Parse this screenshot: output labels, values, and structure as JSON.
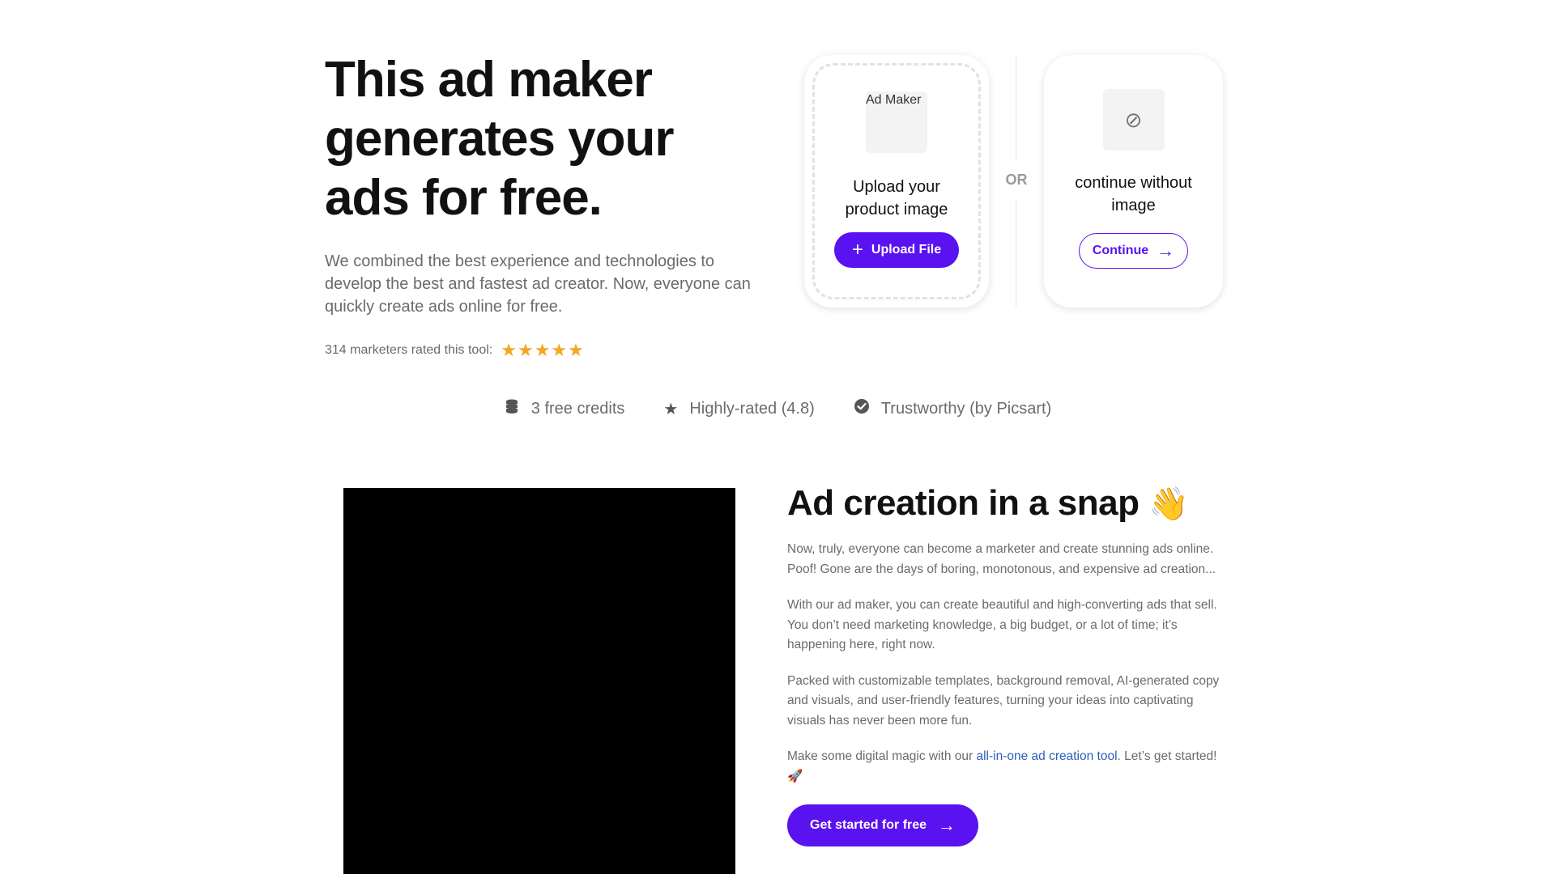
{
  "hero": {
    "title_line1": "This ad maker",
    "title_line2": "generates your",
    "title_line3": "ads for free.",
    "description": "We combined the best experience and technologies to develop the best and fastest ad creator. Now, everyone can quickly create ads online for free.",
    "rating_text": "314 marketers rated this tool:",
    "stars": 5,
    "star_color": "#f5a623"
  },
  "upload_card": {
    "image_alt": "Ad Maker",
    "text_line1": "Upload your",
    "text_line2": "product image",
    "button_label": "Upload File",
    "button_icon": "plus-icon"
  },
  "divider": {
    "or_label": "OR"
  },
  "skip_card": {
    "icon": "ban-icon",
    "text_line1": "continue without",
    "text_line2": "image",
    "button_label": "Continue",
    "button_icon": "arrow-right-icon"
  },
  "features": [
    {
      "icon": "coins-icon",
      "label": "3 free credits"
    },
    {
      "icon": "star-icon",
      "label": "Highly-rated (4.8)"
    },
    {
      "icon": "check-circle-icon",
      "label": "Trustworthy (by Picsart)"
    }
  ],
  "snap_section": {
    "title": "Ad creation in a snap",
    "title_emoji": "👋",
    "paragraph1": "Now, truly, everyone can become a marketer and create stunning ads online. Poof! Gone are the days of boring, monotonous, and expensive ad creation...",
    "paragraph2": "With our ad maker, you can create beautiful and high-converting ads that sell. You don’t need marketing knowledge, a big budget, or a lot of time; it’s happening here, right now.",
    "paragraph3": "Packed with customizable templates, background removal, AI-generated copy and visuals, and user-friendly features, turning your ideas into captivating visuals has never been more fun.",
    "paragraph4_before": "Make some digital magic with our ",
    "paragraph4_link": "all-in-one ad creation tool",
    "paragraph4_after": ". Let’s get started! 🚀",
    "cta_label": "Get started for free"
  },
  "colors": {
    "accent": "#5a12f0",
    "text_muted": "#6b6b6b",
    "link": "#2c5fb8"
  }
}
